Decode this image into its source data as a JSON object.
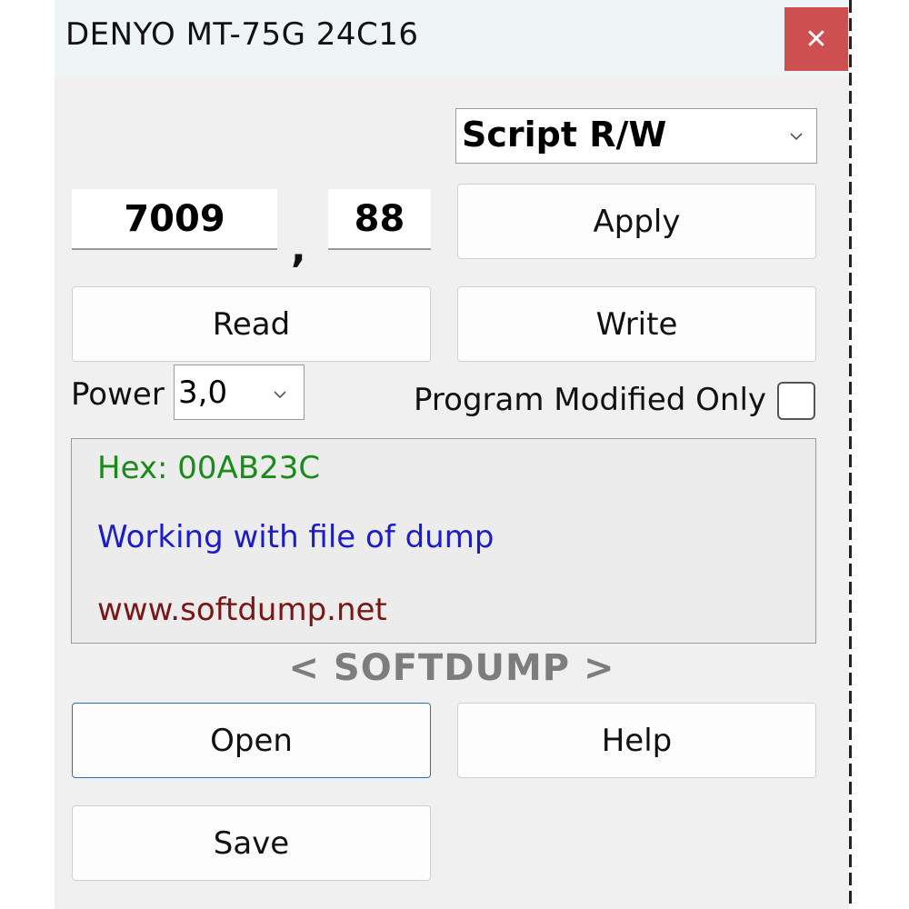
{
  "window": {
    "title": "DENYO MT-75G 24C16",
    "close_glyph": "✕"
  },
  "mode_select": {
    "value": "Script R/W",
    "icon": "chevron-down-icon"
  },
  "address": {
    "value1": "7009",
    "separator": ",",
    "value2": "88"
  },
  "buttons": {
    "apply": "Apply",
    "read": "Read",
    "write": "Write",
    "open": "Open",
    "help": "Help",
    "save": "Save"
  },
  "power": {
    "label": "Power",
    "value": "3,0"
  },
  "program_modified_only": {
    "label": "Program Modified Only",
    "checked": false
  },
  "info": {
    "hex": "Hex: 00AB23C",
    "status": "Working with file of dump",
    "website": "www.softdump.net",
    "colors": {
      "hex": "#1a8a1a",
      "status": "#1c1cc8",
      "website": "#7a1616"
    }
  },
  "brand": "< SOFTDUMP >",
  "colors": {
    "close_button": "#cd4f4f",
    "window_bg": "#f0f0f0",
    "titlebar_bg": "#eff4f7",
    "focus_border": "#2a6fb5"
  }
}
